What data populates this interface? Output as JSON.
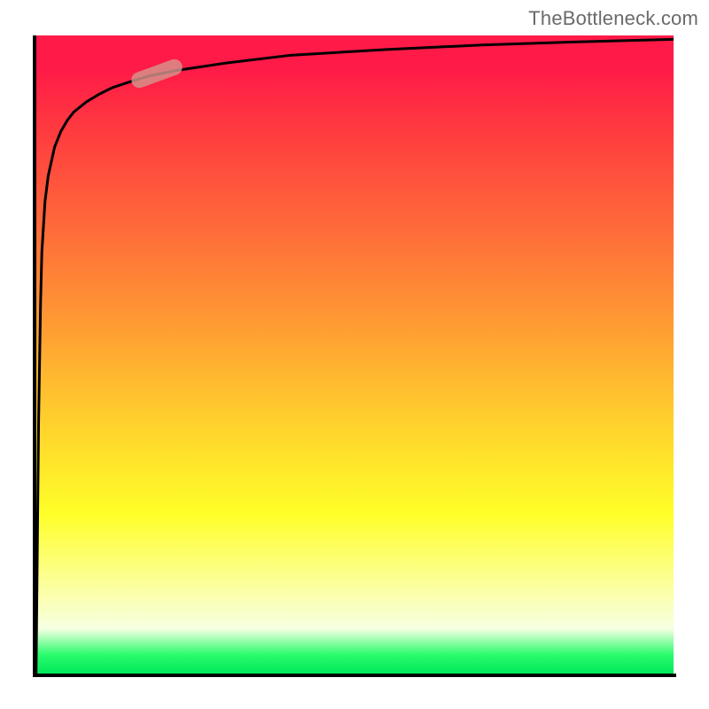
{
  "attribution": "TheBottleneck.com",
  "colors": {
    "axis": "#000000",
    "curve": "#000000",
    "marker": "#d6948c",
    "gradient_stops": [
      "#ff1a48",
      "#ff3b3f",
      "#ff6a3a",
      "#ff9a33",
      "#ffcf2d",
      "#ffff28",
      "#fbffb0",
      "#2bfc6d",
      "#00e85a"
    ]
  },
  "chart_data": {
    "type": "line",
    "title": "",
    "xlabel": "",
    "ylabel": "",
    "xlim": [
      0,
      100
    ],
    "ylim": [
      0,
      100
    ],
    "x": [
      0.1,
      0.3,
      0.5,
      0.8,
      1.0,
      1.5,
      2,
      3,
      4,
      5,
      6,
      8,
      10,
      12,
      15,
      18,
      22,
      30,
      40,
      55,
      70,
      85,
      100
    ],
    "y": [
      0,
      20,
      40,
      58,
      66,
      74,
      78,
      82.5,
      85,
      86.7,
      88,
      89.6,
      90.8,
      91.8,
      92.8,
      93.7,
      94.5,
      95.7,
      96.9,
      97.8,
      98.5,
      99.0,
      99.4
    ],
    "marker": {
      "x": 19,
      "y": 94,
      "angle_deg": -20
    },
    "notes": "Curve rises extremely steeply near x=0 then asymptotically approaches ~100. Background is a vertical red-to-green gradient (red high y, green low y)."
  }
}
